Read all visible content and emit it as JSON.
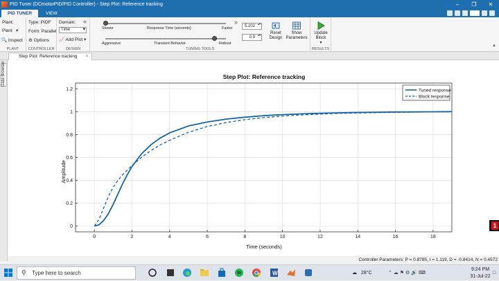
{
  "window": {
    "title": "PID Tuner (DCmotorPID/PID Controller) - Step Plot: Reference tracking",
    "controls": [
      "minimize",
      "restore",
      "close"
    ]
  },
  "tabs": [
    {
      "label": "PID TUNER",
      "active": true
    },
    {
      "label": "VIEW",
      "active": false
    }
  ],
  "ribbon": {
    "plant": {
      "label": "Plant:",
      "dropdown": "Plant",
      "inspect_label": "Inspect",
      "group_label": "PLANT"
    },
    "controller": {
      "type_label": "Type: PIDF",
      "form_label": "Form: Parallel",
      "options_label": "Options",
      "group_label": "CONTROLLER"
    },
    "design": {
      "domain_label": "Domain:",
      "domain_value": "Time",
      "add_plot_label": "Add Plot",
      "group_label": "DESIGN"
    },
    "tuning": {
      "response_time": {
        "left": "Slower",
        "center": "Response Time (seconds)",
        "right": "Faster",
        "value": "5.202",
        "slider_fraction": 0.0
      },
      "transient": {
        "left": "Aggressive",
        "center": "Transient Behavior",
        "right": "Robust",
        "value": "0.9",
        "slider_fraction": 0.9
      },
      "reset_label": "Reset Design",
      "show_params_label": "Show Parameters",
      "group_label": "TUNING TOOLS"
    },
    "results": {
      "update_label": "Update Block",
      "group_label": "RESULTS"
    }
  },
  "doc_tab": {
    "label": "Step Plot: Reference tracking"
  },
  "sidebar": {
    "label": "Data Browser"
  },
  "chart_data": {
    "type": "line",
    "title": "Step Plot: Reference tracking",
    "xlabel": "Time (seconds)",
    "ylabel": "Amplitude",
    "xlim": [
      -1,
      19
    ],
    "ylim": [
      -0.05,
      1.25
    ],
    "xticks": [
      0,
      2,
      4,
      6,
      8,
      10,
      12,
      14,
      16,
      18
    ],
    "yticks": [
      0,
      0.2,
      0.4,
      0.6,
      0.8,
      1,
      1.2
    ],
    "grid": true,
    "legend_position": "top-right",
    "series": [
      {
        "name": "Tuned response",
        "style": "solid",
        "color": "#1565a8",
        "x": [
          0,
          0.25,
          0.5,
          0.75,
          1,
          1.25,
          1.5,
          1.75,
          2,
          2.5,
          3,
          3.5,
          4,
          5,
          6,
          7,
          8,
          9,
          10,
          11,
          12,
          13,
          14,
          15,
          16,
          17,
          18,
          19
        ],
        "y": [
          0,
          0.012,
          0.05,
          0.11,
          0.19,
          0.28,
          0.37,
          0.45,
          0.52,
          0.63,
          0.71,
          0.77,
          0.815,
          0.875,
          0.91,
          0.935,
          0.952,
          0.965,
          0.974,
          0.981,
          0.986,
          0.99,
          0.993,
          0.995,
          0.997,
          0.998,
          0.999,
          1.0
        ]
      },
      {
        "name": "Block response",
        "style": "dashed",
        "color": "#1565a8",
        "x": [
          0,
          0.25,
          0.5,
          0.75,
          1,
          1.25,
          1.5,
          1.75,
          2,
          2.5,
          3,
          3.5,
          4,
          5,
          6,
          7,
          8,
          9,
          10,
          11,
          12,
          13,
          14,
          15,
          16,
          17,
          18,
          19
        ],
        "y": [
          0,
          0.06,
          0.16,
          0.26,
          0.34,
          0.4,
          0.45,
          0.49,
          0.53,
          0.6,
          0.66,
          0.71,
          0.75,
          0.82,
          0.87,
          0.905,
          0.93,
          0.948,
          0.962,
          0.972,
          0.979,
          0.985,
          0.989,
          0.992,
          0.994,
          0.996,
          0.998,
          0.999
        ]
      }
    ]
  },
  "status_bar": {
    "text": "Controller Parameters: P = 0.8785, I = 1.119, D = -0.8414, N = 0.4572"
  },
  "taskbar": {
    "search_placeholder": "Type here to search",
    "temperature": "28°C",
    "time": "9:24 PM",
    "date": "31-Jul-22",
    "apps": [
      "task-view",
      "edge",
      "file-explorer",
      "store",
      "spotify",
      "chrome",
      "word",
      "matlab",
      "app"
    ]
  },
  "overlay_badge": {
    "text": "1"
  }
}
